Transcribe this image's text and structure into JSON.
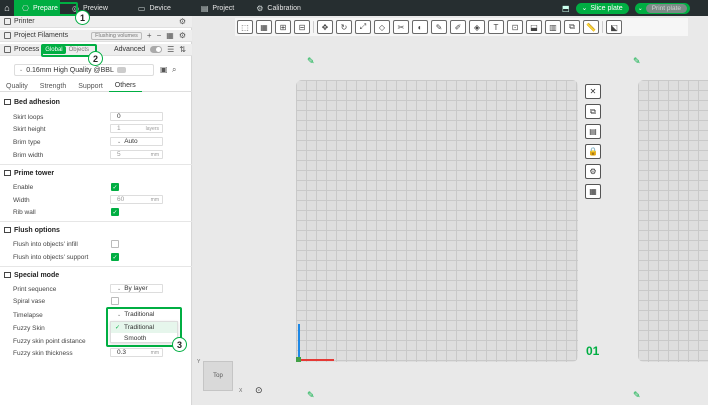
{
  "topbar": {
    "tabs": [
      {
        "label": "Prepare",
        "icon": "prepare-icon",
        "active": true
      },
      {
        "label": "Preview",
        "icon": "preview-icon",
        "active": false
      },
      {
        "label": "Device",
        "icon": "device-icon",
        "active": false
      },
      {
        "label": "Project",
        "icon": "project-icon",
        "active": false
      },
      {
        "label": "Calibration",
        "icon": "calibration-icon",
        "active": false
      }
    ],
    "slice_label": "Slice plate",
    "print_label": "Print plate"
  },
  "sidebar": {
    "printer_label": "Printer",
    "filaments_label": "Project Filaments",
    "flushing_chip": "Flushing volumes",
    "process_label": "Process",
    "global_label": "Global",
    "objects_label": "Objects",
    "advanced_label": "Advanced",
    "preset_name": "0.16mm High Quality @BBL",
    "tabs": [
      "Quality",
      "Strength",
      "Support",
      "Others"
    ],
    "active_tab": "Others"
  },
  "groups": {
    "bed_adhesion": {
      "title": "Bed adhesion",
      "skirt_loops_label": "Skirt loops",
      "skirt_loops_value": "0",
      "skirt_height_label": "Skirt height",
      "skirt_height_value": "1",
      "skirt_height_unit": "layers",
      "brim_type_label": "Brim type",
      "brim_type_value": "Auto",
      "brim_width_label": "Brim width",
      "brim_width_value": "5",
      "brim_width_unit": "mm"
    },
    "prime_tower": {
      "title": "Prime tower",
      "enable_label": "Enable",
      "width_label": "Width",
      "width_value": "60",
      "width_unit": "mm",
      "rib_wall_label": "Rib wall"
    },
    "flush_options": {
      "title": "Flush options",
      "infill_label": "Flush into objects' infill",
      "support_label": "Flush into objects' support"
    },
    "special_mode": {
      "title": "Special mode",
      "print_sequence_label": "Print sequence",
      "print_sequence_value": "By layer",
      "spiral_vase_label": "Spiral vase",
      "timelapse_label": "Timelapse",
      "timelapse_value": "Traditional",
      "fuzzy_skin_label": "Fuzzy Skin",
      "fuzzy_point_label": "Fuzzy skin point distance",
      "fuzzy_thickness_label": "Fuzzy skin thickness",
      "fuzzy_thickness_value": "0.3",
      "fuzzy_thickness_unit": "mm",
      "dropdown_options": [
        "Traditional",
        "Smooth"
      ],
      "dropdown_selected": "Traditional"
    }
  },
  "callouts": [
    "1",
    "2",
    "3"
  ],
  "canvas": {
    "plate_number": "01",
    "viewcube_label": "Top",
    "viewcube_axis_x": "X",
    "viewcube_axis_y": "Y"
  },
  "colors": {
    "accent": "#00ae42",
    "topbar": "#262e30"
  }
}
